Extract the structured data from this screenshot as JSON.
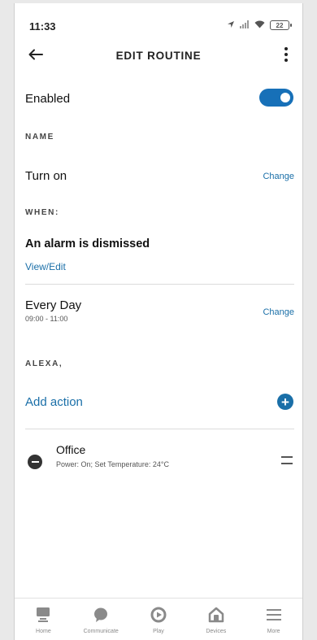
{
  "status_bar": {
    "time": "11:33",
    "battery": "22"
  },
  "header": {
    "title": "EDIT ROUTINE"
  },
  "enabled": {
    "label": "Enabled",
    "on": true
  },
  "name_section": {
    "header": "NAME",
    "value": "Turn on",
    "action": "Change"
  },
  "when_section": {
    "header": "WHEN:",
    "trigger": "An alarm is dismissed",
    "edit_link": "View/Edit",
    "schedule": "Every Day",
    "time_range": "09:00 - 11:00",
    "action": "Change"
  },
  "alexa_section": {
    "header": "ALEXA,",
    "add_action": "Add action",
    "actions": [
      {
        "title": "Office",
        "detail": "Power: On; Set Temperature: 24°C"
      }
    ]
  },
  "bottom_nav": {
    "items": [
      {
        "label": "Home",
        "icon": "home-icon"
      },
      {
        "label": "Communicate",
        "icon": "chat-bubble-icon"
      },
      {
        "label": "Play",
        "icon": "play-icon"
      },
      {
        "label": "Devices",
        "icon": "devices-house-icon"
      },
      {
        "label": "More",
        "icon": "menu-icon"
      }
    ]
  },
  "colors": {
    "accent": "#1a6fa8",
    "toggle": "#1770b8"
  }
}
